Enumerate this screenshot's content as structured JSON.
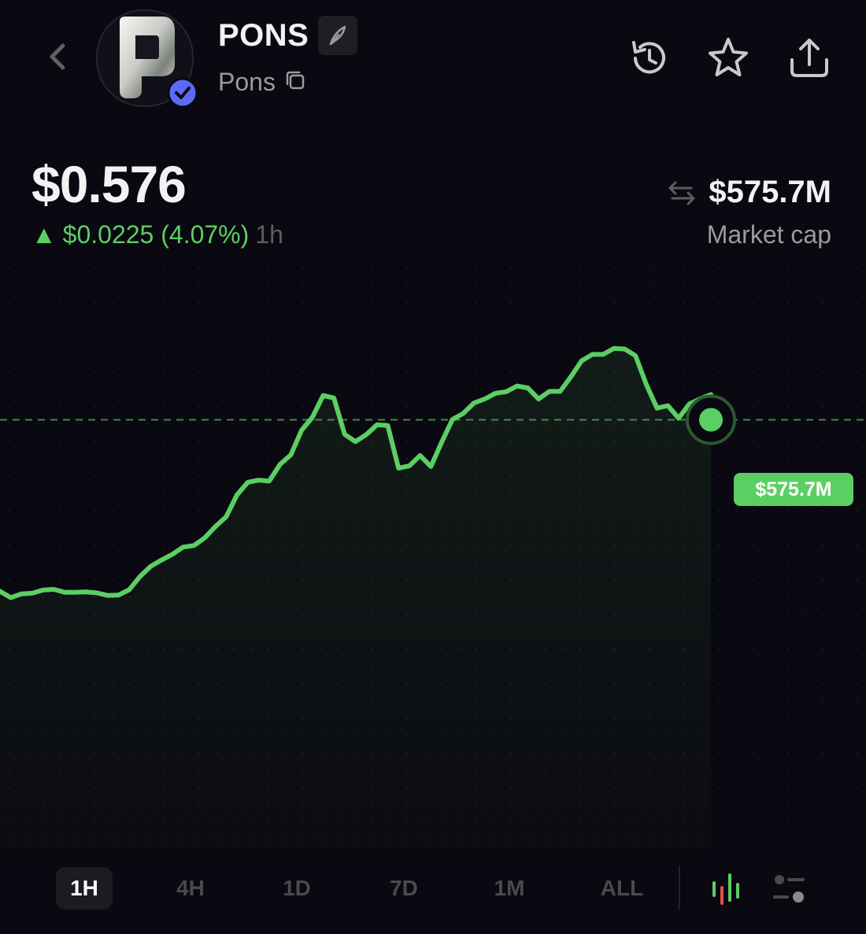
{
  "header": {
    "coin_name": "PONS",
    "coin_subtitle": "Pons",
    "icons": [
      "back-chevron-icon",
      "quill-icon",
      "copy-icon",
      "history-icon",
      "star-icon",
      "share-icon",
      "verified-icon"
    ]
  },
  "price": {
    "current": "$0.576",
    "change_arrow": "▲",
    "change_text": "$0.0225 (4.07%)",
    "timeframe": "1h"
  },
  "market_cap": {
    "value": "$575.7M",
    "label": "Market cap"
  },
  "chart_data": {
    "type": "line",
    "current_label": "$575.7M",
    "reference_line": 575.7,
    "ylim": [
      452,
      599
    ],
    "line_color": "#5bcf63",
    "y": [
      521.4,
      519.4,
      520.6,
      520.8,
      521.8,
      522.0,
      521.1,
      521.1,
      521.2,
      520.9,
      520.1,
      520.2,
      521.9,
      526.1,
      529.3,
      531.3,
      533.1,
      535.4,
      535.9,
      538.3,
      541.9,
      545.0,
      551.9,
      555.9,
      556.6,
      556.3,
      561.6,
      564.6,
      572.4,
      576.5,
      583.4,
      582.6,
      571.1,
      568.8,
      571.0,
      574.1,
      573.9,
      560.4,
      561.1,
      564.4,
      560.9,
      568.6,
      575.8,
      577.7,
      581.0,
      582.3,
      584.1,
      584.6,
      586.4,
      585.8,
      582.3,
      584.7,
      584.7,
      589.3,
      594.4,
      596.4,
      596.4,
      598.3,
      598.1,
      596.0,
      586.9,
      579.4,
      580.2,
      576.2,
      580.7,
      582.3,
      583.7
    ]
  },
  "timeframes": {
    "t1": "1H",
    "t2": "4H",
    "t3": "1D",
    "t4": "7D",
    "t5": "1M",
    "t6": "ALL",
    "active": "1H"
  },
  "colors": {
    "background": "#0a0810",
    "up": "#5bcf63",
    "verified": "#5b6bf5",
    "muted": "#9a9aa0"
  }
}
